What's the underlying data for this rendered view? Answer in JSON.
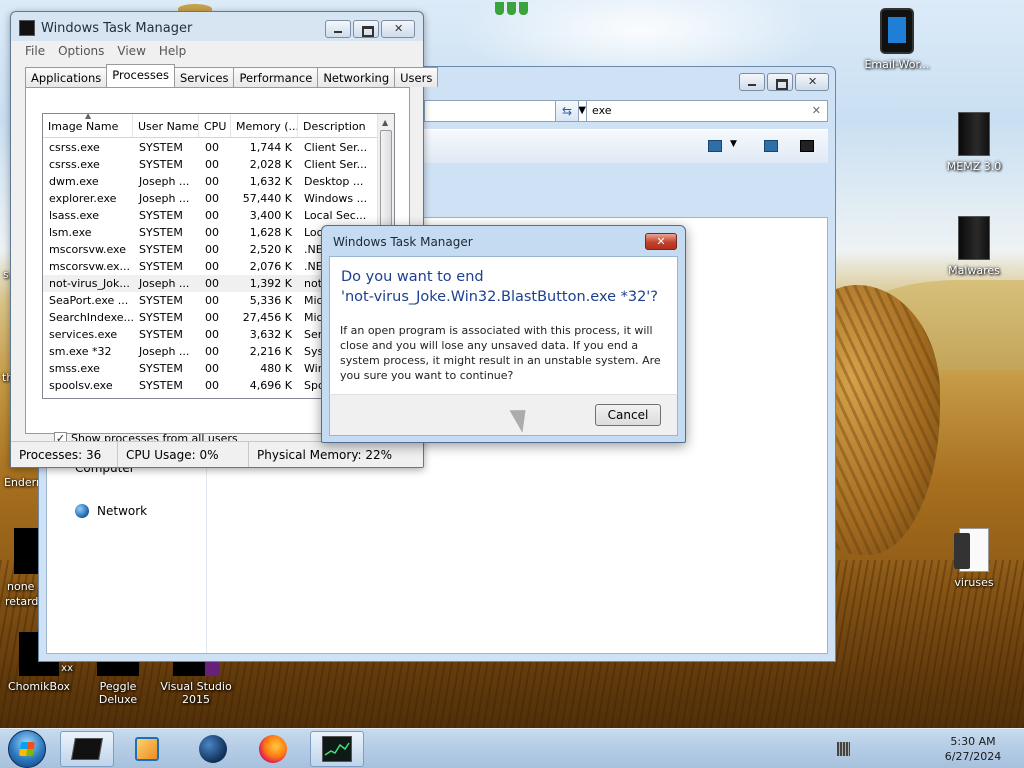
{
  "desktop": {
    "right_icons": [
      {
        "label": "Email-Wor..."
      },
      {
        "label": "MEMZ 3.0"
      },
      {
        "label": "Malwares"
      },
      {
        "label": "viruses"
      }
    ],
    "left_labels": {
      "th": "th",
      "s": "s",
      "enderm": "Enderm",
      "none": "none",
      "retards": "retards",
      "xx": "xx"
    },
    "bottom_icons": [
      {
        "label": "ChomikBox"
      },
      {
        "label": "Peggle Deluxe"
      },
      {
        "label": "Visual Studio 2015"
      }
    ]
  },
  "explorer": {
    "search_value": "exe",
    "nav": {
      "computer_label": "Computer",
      "network_label": "Network"
    }
  },
  "taskmgr": {
    "title": "Windows Task Manager",
    "menu": [
      "File",
      "Options",
      "View",
      "Help"
    ],
    "tabs": [
      "Applications",
      "Processes",
      "Services",
      "Performance",
      "Networking",
      "Users"
    ],
    "active_tab": "Processes",
    "columns": [
      "Image Name",
      "User Name",
      "CPU",
      "Memory (...",
      "Description"
    ],
    "rows": [
      {
        "name": "csrss.exe",
        "user": "SYSTEM",
        "cpu": "00",
        "mem": "1,744 K",
        "desc": "Client Ser..."
      },
      {
        "name": "csrss.exe",
        "user": "SYSTEM",
        "cpu": "00",
        "mem": "2,028 K",
        "desc": "Client Ser..."
      },
      {
        "name": "dwm.exe",
        "user": "Joseph ...",
        "cpu": "00",
        "mem": "1,632 K",
        "desc": "Desktop ..."
      },
      {
        "name": "explorer.exe",
        "user": "Joseph ...",
        "cpu": "00",
        "mem": "57,440 K",
        "desc": "Windows ..."
      },
      {
        "name": "lsass.exe",
        "user": "SYSTEM",
        "cpu": "00",
        "mem": "3,400 K",
        "desc": "Local Sec..."
      },
      {
        "name": "lsm.exe",
        "user": "SYSTEM",
        "cpu": "00",
        "mem": "1,628 K",
        "desc": "Local Ses..."
      },
      {
        "name": "mscorsvw.exe",
        "user": "SYSTEM",
        "cpu": "00",
        "mem": "2,520 K",
        "desc": ".NE"
      },
      {
        "name": "mscorsvw.ex...",
        "user": "SYSTEM",
        "cpu": "00",
        "mem": "2,076 K",
        "desc": ".NE"
      },
      {
        "name": "not-virus_Jok...",
        "user": "Joseph ...",
        "cpu": "00",
        "mem": "1,392 K",
        "desc": "not"
      },
      {
        "name": "SeaPort.exe ...",
        "user": "SYSTEM",
        "cpu": "00",
        "mem": "5,336 K",
        "desc": "Mic"
      },
      {
        "name": "SearchIndexe...",
        "user": "SYSTEM",
        "cpu": "00",
        "mem": "27,456 K",
        "desc": "Mic"
      },
      {
        "name": "services.exe",
        "user": "SYSTEM",
        "cpu": "00",
        "mem": "3,632 K",
        "desc": "Ser"
      },
      {
        "name": "sm.exe *32",
        "user": "Joseph ...",
        "cpu": "00",
        "mem": "2,216 K",
        "desc": "Sys"
      },
      {
        "name": "smss.exe",
        "user": "SYSTEM",
        "cpu": "00",
        "mem": "480 K",
        "desc": "Win"
      },
      {
        "name": "spoolsv.exe",
        "user": "SYSTEM",
        "cpu": "00",
        "mem": "4,696 K",
        "desc": "Spo"
      }
    ],
    "show_all_label": "Show processes from all users",
    "show_all_checked": true,
    "status": {
      "processes": "Processes: 36",
      "cpu": "CPU Usage: 0%",
      "memory": "Physical Memory: 22%"
    }
  },
  "dialog": {
    "title": "Windows Task Manager",
    "heading_line1": "Do you want to end",
    "heading_line2": "'not-virus_Joke.Win32.BlastButton.exe *32'?",
    "message": "If an open program is associated with this process, it will close and you will lose any unsaved data. If you end a system process, it might result in an unstable system. Are you sure you want to continue?",
    "cancel_label": "Cancel"
  },
  "taskbar": {
    "time": "5:30 AM",
    "date": "6/27/2024",
    "pinned": [
      "black-app-icon",
      "media-player-icon",
      "globe-app-icon",
      "firefox-icon",
      "task-manager-icon"
    ]
  },
  "colors": {
    "dialog_heading": "#1d3f8f",
    "close_red": "#c4422d",
    "taskbar": "#b6cde6"
  }
}
